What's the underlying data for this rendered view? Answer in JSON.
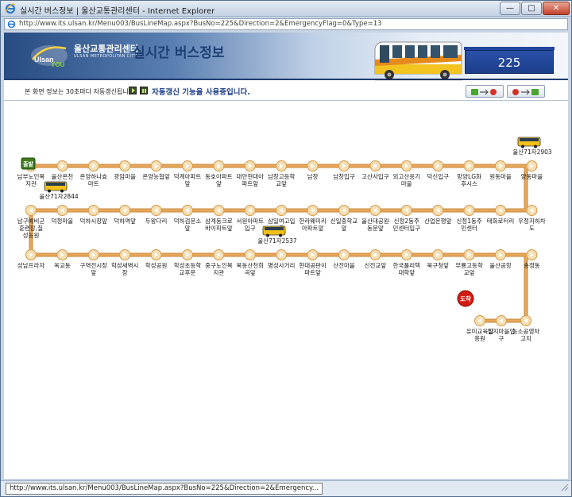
{
  "window": {
    "title": "실시간 버스정보 | 울산교통관리센터 - Internet Explorer",
    "address": "http://www.its.ulsan.kr/Menu003/BusLineMap.aspx?BusNo=225&Direction=2&EmergencyFlag=0&Type=13",
    "min_label": "—",
    "max_label": "□",
    "close_label": "✕",
    "status": "http://www.its.ulsan.kr/Menu003/BusLineMap.aspx?BusNo=225&Direction=2&Emergency..."
  },
  "header": {
    "logo_text": "Ulsan You",
    "org_kr": "울산교통관리센터",
    "org_en": "ULSAN METROPOLITAN CITY",
    "page_title": "실시간 버스정보",
    "bus_number": "225"
  },
  "infobar": {
    "refresh_note": "본 화면 정보는 30초마다 자동갱신됩니다.",
    "auto_refresh_status": "자동갱신 기능을 사용중입니다."
  },
  "colors": {
    "route_line": "#e9a659",
    "stop_fill": "#f4dfb4",
    "stop_stroke": "#d79845",
    "start_badge": "#3f7a1f",
    "end_badge": "#d21c12",
    "label": "#1a1a1a",
    "bus_label": "#1a1a1a"
  },
  "route": {
    "start_badge": "출발",
    "end_badge": "도착",
    "row1": [
      "남부노인복\n지관",
      "울산온천",
      "온양하나효\n마트",
      "광암마을",
      "온양농협앞",
      "덕계아파트\n앞",
      "동호아파트\n앞",
      "대안현대아\n파트앞",
      "남창고등학\n교앞",
      "남창",
      "남창입구",
      "고산사입구",
      "외고산옹기\n마을",
      "덕신입구",
      "망양LG화\n후시스",
      "원동마을",
      "양동마을"
    ],
    "row2": [
      "우정지하차\n도",
      "태화로터리",
      "신정1동주\n민센터",
      "산업은행앞",
      "신정2동주\n민센터입구",
      "울산대공원\n동문앞",
      "신일중학교\n앞",
      "한라웨미리\n아파트앞",
      "삼일여고입\n구",
      "서원아파트\n입구",
      "삼계동크로\n바이피트앞",
      "덕하검문소\n앞",
      "두왕다리",
      "덕하역앞",
      "덕하시장앞",
      "덕정마을",
      "남구예비군\n훈련장,칠\n성농원"
    ],
    "row3": [
      "성남프라자",
      "옥교동",
      "구역전시장\n앞",
      "학성새벽시\n장",
      "학성공원",
      "학성초등학\n교후문",
      "중구노인복\n지관",
      "북동산천희\n곡앞",
      "명성사거리",
      "현대공판이\n파트앞",
      "산전마을",
      "신전교앞",
      "한국폴리텍\n대학앞",
      "북구청앞",
      "무룡고등학\n교앞",
      "울산공항",
      "송정동"
    ],
    "row4": [
      "농소공영차\n고지",
      "일지마을입\n구",
      "유미교육진\n흥원"
    ],
    "buses": [
      {
        "label": "울산71자2903"
      },
      {
        "label": "울산71자2844"
      },
      {
        "label": "울산71자2537"
      }
    ]
  }
}
